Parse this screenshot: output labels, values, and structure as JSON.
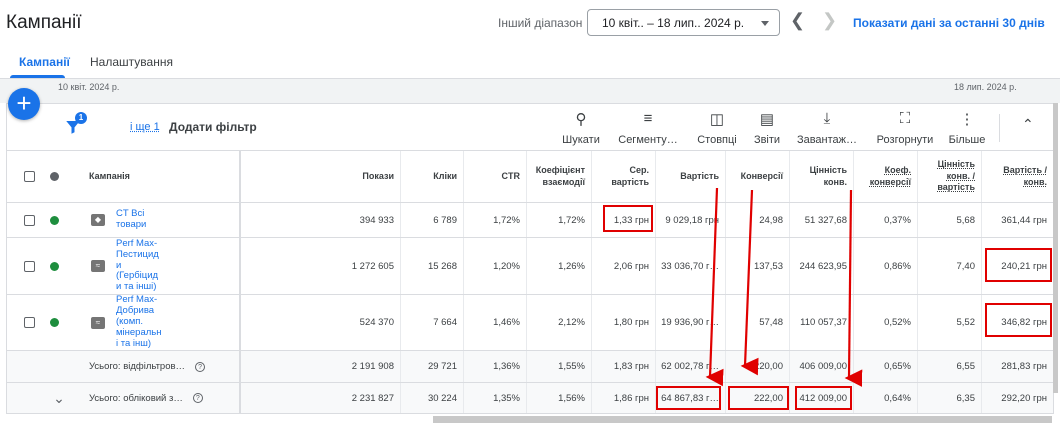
{
  "header": {
    "title": "Кампанії",
    "range_label": "Інший діапазон",
    "date_range": "10 квіт.. – 18 лип.. 2024 р.",
    "last30_link": "Показати дані за останні 30 днів"
  },
  "tabs": [
    {
      "label": "Кампанії",
      "active": true
    },
    {
      "label": "Налаштування",
      "active": false
    }
  ],
  "timeline": {
    "start": "10 квіт. 2024 р.",
    "end": "18 лип. 2024 р."
  },
  "toolbar": {
    "filter_count": "1",
    "and_more": "і ще 1",
    "add_filter": "Додати фільтр",
    "tools": [
      {
        "label": "Шукати",
        "icon": "search-icon"
      },
      {
        "label": "Сегменту…",
        "icon": "segment-icon"
      },
      {
        "label": "Стовпці",
        "icon": "columns-icon"
      },
      {
        "label": "Звіти",
        "icon": "reports-icon"
      },
      {
        "label": "Завантаж…",
        "icon": "download-icon"
      },
      {
        "label": "Розгорнути",
        "icon": "expand-icon"
      },
      {
        "label": "Більше",
        "icon": "more-icon"
      }
    ]
  },
  "table": {
    "headers": {
      "campaign": "Кампанія",
      "impr": "Покази",
      "clicks": "Кліки",
      "ctr": "CTR",
      "conv_rate": "Коефіцієнт взаємодії",
      "avg_cpc": "Сер. вартість",
      "cost": "Вартість",
      "conv": "Конверсії",
      "conv_value": "Цінність конв.",
      "conv_rate2": "Коеф. конверсії",
      "value_cost": "Цінність конв. / вартість",
      "cost_conv": "Вартість / конв."
    },
    "rows": [
      {
        "name": "CT Всі товари",
        "impr": "394 933",
        "clicks": "6 789",
        "ctr": "1,72%",
        "conv_rate": "1,72%",
        "avg_cpc": "1,33 грн",
        "cost": "9 029,18 грн",
        "conv": "24,98",
        "conv_value": "51 327,68",
        "conv_rate2": "0,37%",
        "value_cost": "5,68",
        "cost_conv": "361,44 грн"
      },
      {
        "name": "Perf Max-Пестицид и (Гербіцид и та інші)",
        "impr": "1 272 605",
        "clicks": "15 268",
        "ctr": "1,20%",
        "conv_rate": "1,26%",
        "avg_cpc": "2,06 грн",
        "cost": "33 036,70 г…",
        "conv": "137,53",
        "conv_value": "244 623,95",
        "conv_rate2": "0,86%",
        "value_cost": "7,40",
        "cost_conv": "240,21 грн"
      },
      {
        "name": "Perf Max-Добрива (комп. мінеральн і та інш)",
        "impr": "524 370",
        "clicks": "7 664",
        "ctr": "1,46%",
        "conv_rate": "2,12%",
        "avg_cpc": "1,80 грн",
        "cost": "19 936,90 г…",
        "conv": "57,48",
        "conv_value": "110 057,37",
        "conv_rate2": "0,52%",
        "value_cost": "5,52",
        "cost_conv": "346,82 грн"
      }
    ],
    "totals": [
      {
        "label": "Усього: відфільтров…",
        "impr": "2 191 908",
        "clicks": "29 721",
        "ctr": "1,36%",
        "conv_rate": "1,55%",
        "avg_cpc": "1,83 грн",
        "cost": "62 002,78 г…",
        "conv": "220,00",
        "conv_value": "406 009,00",
        "conv_rate2": "0,65%",
        "value_cost": "6,55",
        "cost_conv": "281,83 грн"
      },
      {
        "label": "Усього: обліковий з…",
        "impr": "2 231 827",
        "clicks": "30 224",
        "ctr": "1,35%",
        "conv_rate": "1,56%",
        "avg_cpc": "1,86 грн",
        "cost": "64 867,83 г…",
        "conv": "222,00",
        "conv_value": "412 009,00",
        "conv_rate2": "0,64%",
        "value_cost": "6,35",
        "cost_conv": "292,20 грн"
      }
    ]
  },
  "colors": {
    "accent": "#1a73e8",
    "status_enabled": "#1e8e3e",
    "highlight": "#e00000"
  }
}
